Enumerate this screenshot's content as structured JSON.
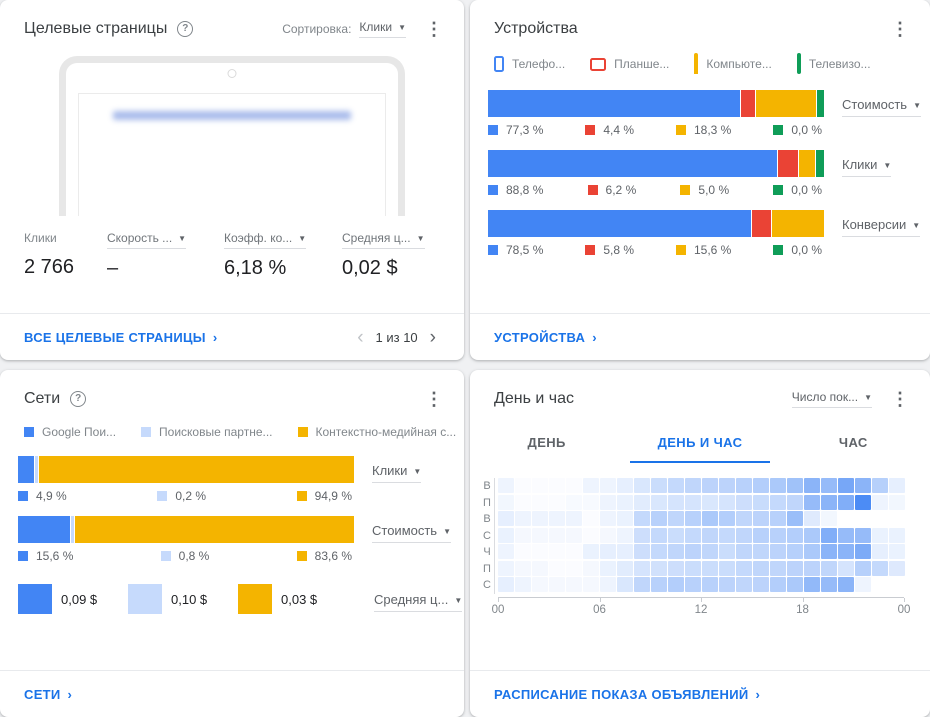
{
  "colors": {
    "blue": "#4285F4",
    "red": "#EA4335",
    "yellow": "#F4B400",
    "green": "#0F9D58",
    "light_blue": "#C6DAFC",
    "link_blue": "#1A73E8"
  },
  "landing_pages": {
    "title": "Целевые страницы",
    "sort_label": "Сортировка:",
    "sort_value": "Клики",
    "stats": [
      {
        "label": "Клики",
        "value": "2 766"
      },
      {
        "label": "Скорость ...",
        "value": "–"
      },
      {
        "label": "Коэфф. ко...",
        "value": "6,18 %"
      },
      {
        "label": "Средняя ц...",
        "value": "0,02 $"
      }
    ],
    "footer_link": "ВСЕ ЦЕЛЕВЫЕ СТРАНИЦЫ",
    "pagination": {
      "prev": "‹",
      "label": "1 из 10",
      "next": "›"
    }
  },
  "devices": {
    "title": "Устройства",
    "legend": [
      {
        "label": "Телефо...",
        "device": "phone",
        "color": "#4285F4"
      },
      {
        "label": "Планше...",
        "device": "tablet",
        "color": "#EA4335"
      },
      {
        "label": "Компьюте...",
        "device": "laptop",
        "color": "#F4B400"
      },
      {
        "label": "Телевизо...",
        "device": "tv",
        "color": "#0F9D58"
      }
    ],
    "colors": [
      "#4285F4",
      "#EA4335",
      "#F4B400",
      "#0F9D58"
    ],
    "rows": [
      {
        "metric": "Стоимость",
        "labels": [
          "77,3 %",
          "4,4 %",
          "18,3 %",
          "0,0 %"
        ],
        "display_widths": [
          75.4,
          4.3,
          17.8,
          2.2
        ]
      },
      {
        "metric": "Клики",
        "labels": [
          "88,8 %",
          "6,2 %",
          "5,0 %",
          "0,0 %"
        ],
        "display_widths": [
          86.4,
          6.0,
          4.9,
          2.4
        ]
      },
      {
        "metric": "Конверсии",
        "labels": [
          "78,5 %",
          "5,8 %",
          "15,6 %",
          "0,0 %"
        ],
        "display_widths": [
          78.6,
          5.8,
          15.6,
          0
        ]
      }
    ],
    "footer_link": "УСТРОЙСТВА"
  },
  "networks": {
    "title": "Сети",
    "legend": [
      {
        "label": "Google Пои...",
        "color": "#4285F4"
      },
      {
        "label": "Поисковые партне...",
        "color": "#C6DAFC"
      },
      {
        "label": "Контекстно-медийная с...",
        "color": "#F4B400"
      }
    ],
    "colors": [
      "#4285F4",
      "#C6DAFC",
      "#F4B400"
    ],
    "rows": [
      {
        "metric": "Клики",
        "labels": [
          "4,9 %",
          "0,2 %",
          "94,9 %"
        ],
        "display_widths": [
          4.9,
          0.7,
          94.4
        ]
      },
      {
        "metric": "Стоимость",
        "labels": [
          "15,6 %",
          "0,8 %",
          "83,6 %"
        ],
        "display_widths": [
          15.6,
          0.8,
          83.6
        ]
      }
    ],
    "avg_row": {
      "metric": "Средняя ц...",
      "blocks": [
        "0,09 $",
        "0,10 $",
        "0,03 $"
      ]
    },
    "footer_link": "СЕТИ"
  },
  "day_hour": {
    "title": "День и час",
    "metric_dropdown": "Число пок...",
    "tabs": [
      "ДЕНЬ",
      "ДЕНЬ И ЧАС",
      "ЧАС"
    ],
    "active_tab": 1,
    "footer_link": "РАСПИСАНИЕ ПОКАЗА ОБЪЯВЛЕНИЙ"
  },
  "chart_data": [
    {
      "type": "bar",
      "title": "Устройства",
      "orientation": "horizontal_stacked_100pct",
      "categories": [
        "Стоимость",
        "Клики",
        "Конверсии"
      ],
      "series": [
        {
          "name": "Телефоны",
          "color": "#4285F4",
          "values": [
            77.3,
            88.8,
            78.5
          ]
        },
        {
          "name": "Планшеты",
          "color": "#EA4335",
          "values": [
            4.4,
            6.2,
            5.8
          ]
        },
        {
          "name": "Компьютеры",
          "color": "#F4B400",
          "values": [
            18.3,
            5.0,
            15.6
          ]
        },
        {
          "name": "Телевизоры",
          "color": "#0F9D58",
          "values": [
            0.0,
            0.0,
            0.0
          ]
        }
      ],
      "unit": "%",
      "legend_position": "top"
    },
    {
      "type": "bar",
      "title": "Сети",
      "orientation": "horizontal_stacked_100pct",
      "categories": [
        "Клики",
        "Стоимость"
      ],
      "series": [
        {
          "name": "Google Поиск",
          "color": "#4285F4",
          "values": [
            4.9,
            15.6
          ]
        },
        {
          "name": "Поисковые партнеры",
          "color": "#C6DAFC",
          "values": [
            0.2,
            0.8
          ]
        },
        {
          "name": "Контекстно-медийная сеть",
          "color": "#F4B400",
          "values": [
            94.9,
            83.6
          ]
        }
      ],
      "extra_row": {
        "category": "Средняя цена за клик",
        "values_usd": [
          0.09,
          0.1,
          0.03
        ],
        "labels": [
          "0,09 $",
          "0,10 $",
          "0,03 $"
        ]
      },
      "unit": "%",
      "legend_position": "top"
    },
    {
      "type": "heatmap",
      "title": "День и час",
      "metric": "Число показов",
      "days": [
        "В",
        "П",
        "В",
        "С",
        "Ч",
        "П",
        "С"
      ],
      "hours_range": [
        0,
        24
      ],
      "x_tick_labels": [
        "00",
        "06",
        "12",
        "18",
        "00"
      ],
      "x_tick_positions_pct": [
        0,
        25,
        50,
        75,
        100
      ],
      "base_color": "#4285F4",
      "matrix": [
        [
          8,
          2,
          2,
          2,
          2,
          8,
          8,
          12,
          18,
          25,
          28,
          30,
          32,
          32,
          34,
          36,
          40,
          45,
          55,
          50,
          65,
          55,
          35,
          12
        ],
        [
          6,
          2,
          2,
          2,
          4,
          4,
          8,
          10,
          14,
          18,
          20,
          20,
          18,
          20,
          24,
          26,
          28,
          30,
          50,
          55,
          60,
          85,
          8,
          6
        ],
        [
          12,
          8,
          8,
          8,
          8,
          2,
          8,
          10,
          28,
          34,
          30,
          34,
          40,
          36,
          30,
          32,
          34,
          48,
          15,
          6,
          0,
          0,
          0,
          0
        ],
        [
          10,
          5,
          5,
          5,
          5,
          2,
          5,
          8,
          24,
          28,
          25,
          28,
          30,
          28,
          30,
          34,
          34,
          36,
          40,
          60,
          50,
          50,
          10,
          10
        ],
        [
          8,
          2,
          2,
          2,
          2,
          10,
          12,
          12,
          24,
          28,
          30,
          32,
          30,
          25,
          30,
          30,
          32,
          35,
          40,
          55,
          55,
          62,
          12,
          10
        ],
        [
          8,
          5,
          5,
          2,
          2,
          5,
          10,
          14,
          20,
          22,
          24,
          25,
          25,
          25,
          28,
          30,
          30,
          32,
          32,
          30,
          20,
          35,
          28,
          16
        ],
        [
          12,
          8,
          5,
          5,
          5,
          5,
          8,
          18,
          30,
          34,
          36,
          34,
          34,
          32,
          30,
          32,
          36,
          40,
          52,
          50,
          55,
          8,
          0,
          0
        ]
      ],
      "scale_note": "relative intensity 0-100"
    }
  ]
}
